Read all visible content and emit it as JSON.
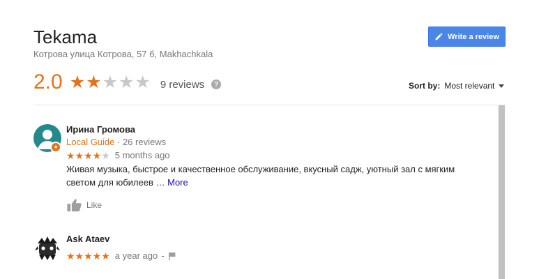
{
  "place": {
    "title": "Tekama",
    "address": "Котрова улица Котрова, 57 б, Makhachkala"
  },
  "write_review": {
    "label": "Write a review",
    "icon": "pencil-icon"
  },
  "rating": {
    "score": "2.0",
    "stars_filled": 2,
    "stars_total": 5,
    "reviews_count": "9 reviews",
    "help_icon": "question-icon"
  },
  "sort": {
    "label": "Sort by:",
    "value": "Most relevant"
  },
  "colors": {
    "accent_orange": "#e7711b",
    "button_blue": "#4a86e8",
    "star_empty": "#c8c8c8",
    "link_blue": "#1a0dab"
  },
  "reviews": [
    {
      "author": "Ирина Громова",
      "guide_label": "Local Guide",
      "guide_count": " · 26 reviews",
      "stars": "★★★★",
      "stars_empty": "★",
      "time": "5 months ago",
      "text": "Живая музыка, быстрое и качественное обслуживание, вкусный садж, уютный зал с мягким светом для юбилеев … ",
      "more": "More",
      "like": "Like"
    },
    {
      "author": "Ask Ataev",
      "stars": "★★★★★",
      "time": "a year ago",
      "separator": "-"
    }
  ]
}
